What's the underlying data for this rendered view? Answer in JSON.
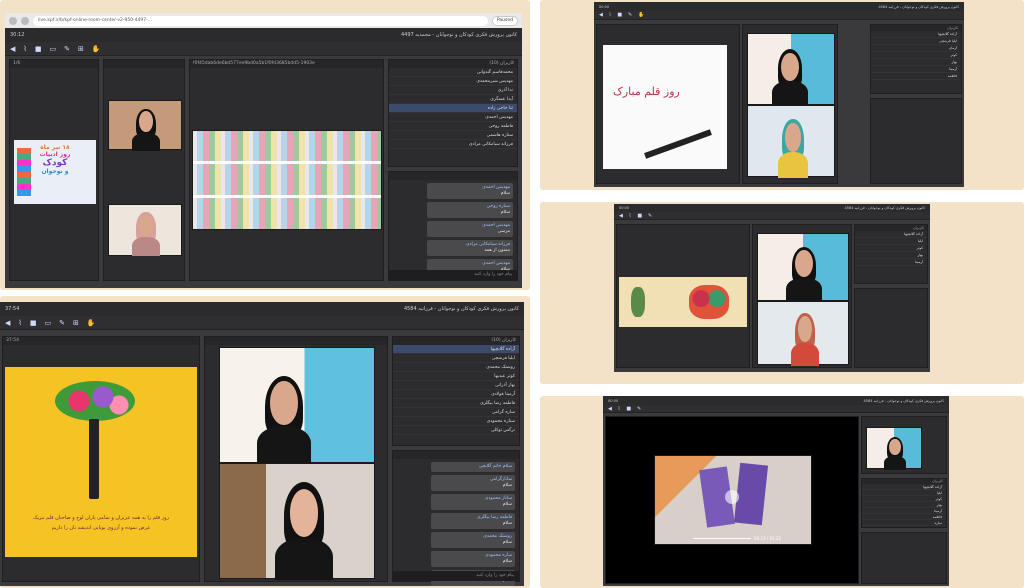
{
  "browser": {
    "url": "live.kpf.ir/b/kpf-online-room-center-v2-950-4497-...",
    "profile_label": "Paused"
  },
  "app": {
    "title_main": "کانون پرورش فکری کودکان و نوجوانان - محمدیه 4497",
    "title_a": "کانون پرورش فکری کودکان و نوجوانان - فرزانیه 4584",
    "title_b": "کانون پرورش فکری کودکان و نوجوانان - فرزانیه 4584",
    "title_c": "کانون پرورش فکری کودکان و نوجوانان - فرزانیه 4584",
    "title_d": "کانون پرورش فکری کودکان و نوجوانان - فرزانیه 4584"
  },
  "timers": {
    "main": "30:12",
    "a": "37:54",
    "b": "00:00",
    "c": "00:00",
    "d": "00:00"
  },
  "main_window": {
    "presentation_label": "1/6",
    "video_label": "f0f45dab6de6bd577ee9bd0a5b1f0fd3685bdd5-1903e",
    "users_header": "کاربران (10)",
    "users": [
      "محمدقاسم گندوانی",
      "مهدیس شیرمحمدی",
      "ندا آذری",
      "آیدا عسگری",
      "ثنا حاجی زاده",
      "مهدیس احمدی",
      "فاطمه روحی",
      "ستاره هاشمی",
      "فرزانه سیامکانی مرادی"
    ],
    "book_text_1": "۱۸ تیر ماه",
    "book_text_2": "روز ادبیات",
    "book_text_3": "کودک",
    "book_text_4": "و نوجوان",
    "chat": [
      {
        "name": "مهدیس احمدی",
        "text": "سلام"
      },
      {
        "name": "ستاره روحی",
        "text": "سلام"
      },
      {
        "name": "مهدیس احمدی",
        "text": "مرسی"
      },
      {
        "name": "فرزانه سیامکانی مرادی",
        "text": "ممنون از همه"
      },
      {
        "name": "مهدیس احمدی",
        "text": "سلام"
      }
    ],
    "chat_placeholder": "پیام خود را وارد کنید"
  },
  "window_a": {
    "presentation_timer": "00:05",
    "users_header": "کاربران (10)",
    "users": [
      "آزاده گلابچیها",
      "ایلیا فرشچی",
      "روشنک محمدی",
      "کوثر عبدیها",
      "بهار آذرانی",
      "آرمیتا فولادی",
      "فاطمه رضا بیگلری",
      "ساره گرامی",
      "ستاره محمودی",
      "نرگس توکلی"
    ],
    "card_text_1": "روز قلم را به همه عزیزان و تمامی یاران لوح و صاحبان قلم تبریک",
    "card_text_2": "عرض نموده و آرزوی پویایی اندیشه تان را داریم",
    "chat": [
      {
        "name": "سلام خانم گلابچی",
        "text": ""
      },
      {
        "name": "سانازگرامی",
        "text": "سلام"
      },
      {
        "name": "ساناز محمودی",
        "text": "سلام"
      },
      {
        "name": "فاطمه رضا بیگلری",
        "text": "سلام"
      },
      {
        "name": "روشنک محمدی",
        "text": "سلام"
      },
      {
        "name": "ساره محمودی",
        "text": "سلام"
      },
      {
        "name": "نرگس توکلی",
        "text": "سلام"
      }
    ],
    "chat_placeholder": "پیام خود را وارد کنید"
  },
  "window_b": {
    "users_header": "کاربران",
    "users": [
      "آزاده گلابچیها",
      "ایلیا فرشچی",
      "آرمان",
      "کوثر",
      "بهار",
      "آرمیتا",
      "فاطمه"
    ],
    "calligraphy_text": "روز قلم مبارک"
  },
  "window_c": {
    "users_header": "کاربران",
    "users": [
      "آزاده گلابچیها",
      "ایلیا",
      "کوثر",
      "بهار",
      "آرمیتا"
    ]
  },
  "window_d": {
    "users_header": "کاربران",
    "users": [
      "آزاده گلابچیها",
      "ایلیا",
      "کوثر",
      "بهار",
      "آرمیتا",
      "فاطمه",
      "ساره"
    ],
    "video_time": "00:13 / 01:32"
  },
  "colors": {
    "frame_bg": "#f3e2c7",
    "app_bg": "#3a3a3c",
    "accent": "#3c4b6c",
    "yellow_card": "#f6c324"
  }
}
